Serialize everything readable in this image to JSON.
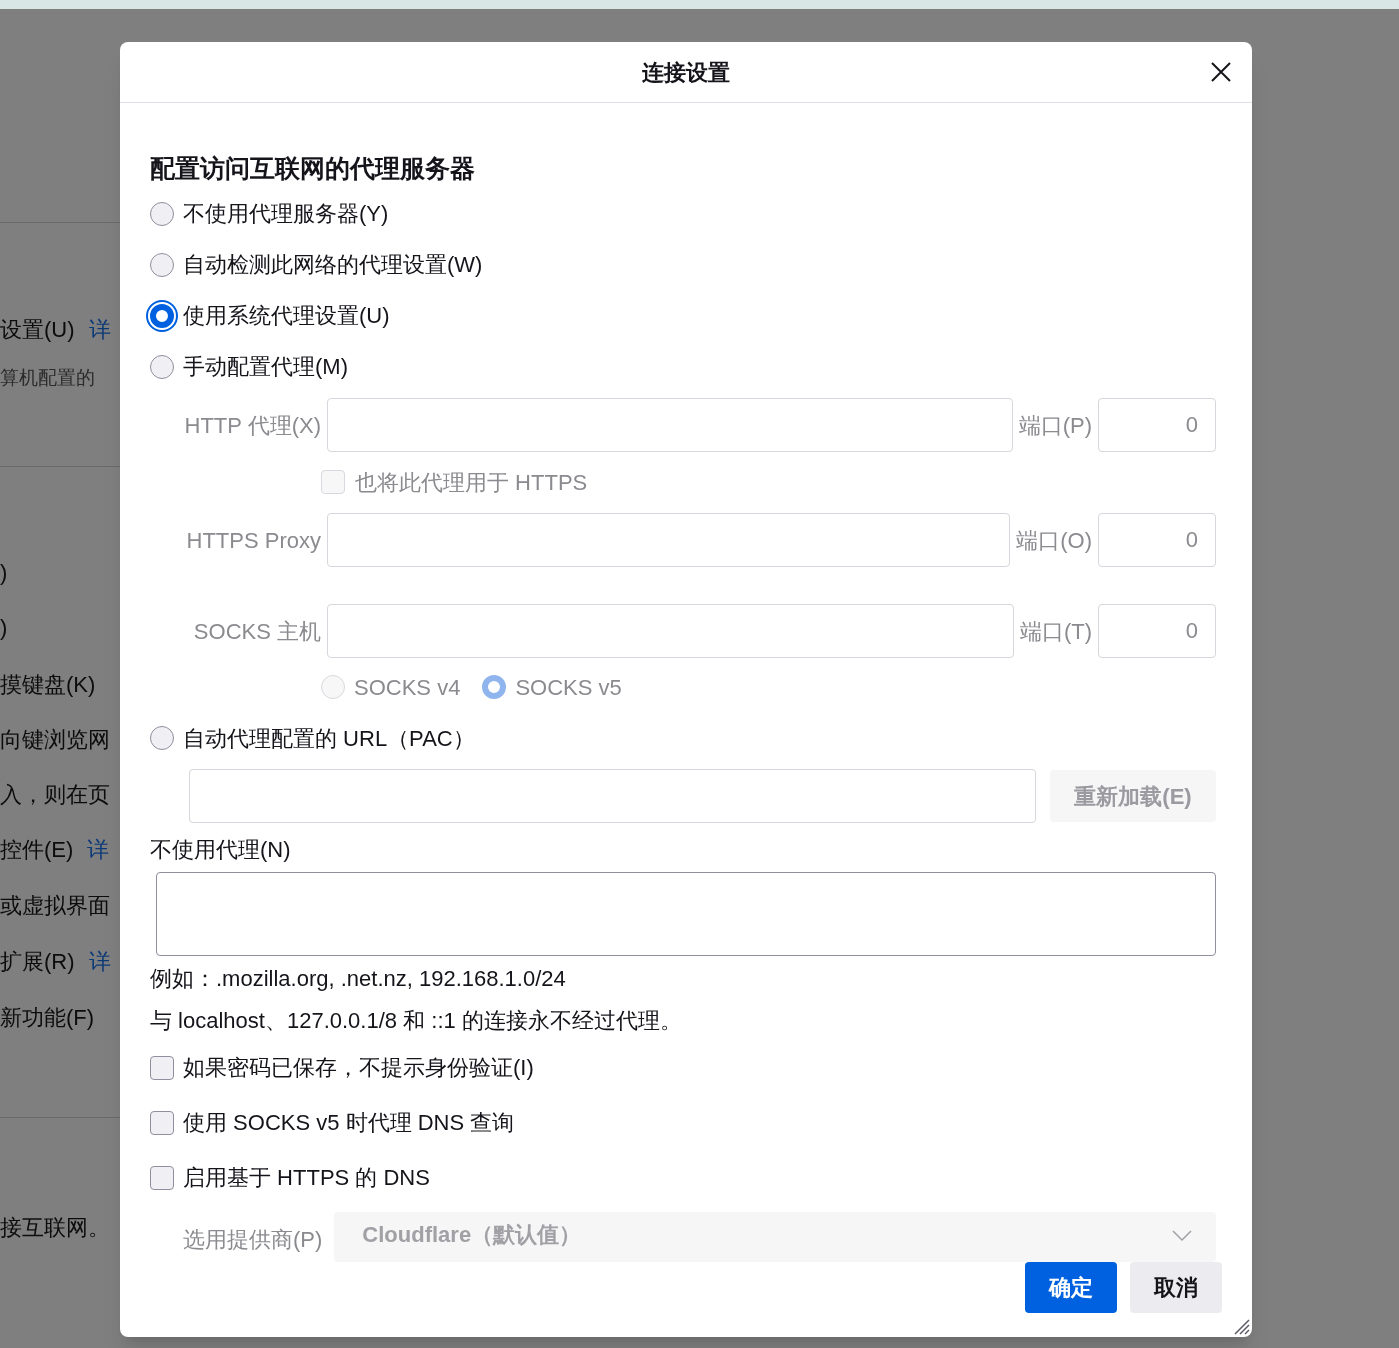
{
  "background_page": [
    {
      "text": "设置(U)",
      "link": "详"
    },
    {
      "text": "算机配置的",
      "kind": "hint"
    },
    {
      "text": ")"
    },
    {
      "text": ")"
    },
    {
      "text": "摸键盘(K)"
    },
    {
      "text": "向键浏览网"
    },
    {
      "text": "入，则在页"
    },
    {
      "text": "控件(E)",
      "link": "详"
    },
    {
      "text": "或虚拟界面"
    },
    {
      "text": "扩展(R)",
      "link": "详"
    },
    {
      "text": "新功能(F)"
    },
    {
      "text": "接互联网。"
    }
  ],
  "window": {
    "title": "连接设置"
  },
  "heading": "配置访问互联网的代理服务器",
  "proxy_modes": [
    {
      "label": "不使用代理服务器(Y)",
      "selected": false
    },
    {
      "label": "自动检测此网络的代理设置(W)",
      "selected": false
    },
    {
      "label": "使用系统代理设置(U)",
      "selected": true
    },
    {
      "label": "手动配置代理(M)",
      "selected": false
    }
  ],
  "manual_rows": [
    {
      "kind": "field",
      "label": "HTTP 代理(X)",
      "disabled": true,
      "port_label": "端口(P)",
      "port_value": "0"
    },
    {
      "kind": "checkbox",
      "label": "也将此代理用于 HTTPS",
      "checked": false,
      "disabled": true
    },
    {
      "kind": "field",
      "label": "HTTPS Proxy",
      "disabled": true,
      "port_label": "端口(O)",
      "port_value": "0"
    },
    {
      "kind": "field",
      "label": "SOCKS 主机",
      "disabled": true,
      "port_label": "端口(T)",
      "port_value": "0"
    },
    {
      "kind": "radios",
      "disabled": true,
      "options": [
        {
          "label": "SOCKS v4",
          "selected": false
        },
        {
          "label": "SOCKS v5",
          "selected": true
        }
      ]
    }
  ],
  "pac": {
    "label": "自动代理配置的 URL（PAC）",
    "selected": false,
    "reload_button": {
      "label": "重新加载(E)",
      "disabled": true
    }
  },
  "no_proxy": {
    "label": "不使用代理(N)",
    "example": "例如：.mozilla.org, .net.nz, 192.168.1.0/24",
    "note": "与 localhost、127.0.0.1/8 和 ::1 的连接永不经过代理。"
  },
  "options": [
    {
      "label": "如果密码已保存，不提示身份验证(I)",
      "checked": false
    },
    {
      "label": "使用 SOCKS v5 时代理 DNS 查询",
      "checked": false
    },
    {
      "label": "启用基于 HTTPS 的 DNS",
      "checked": false
    }
  ],
  "provider": {
    "label": "选用提供商(P)",
    "value": "Cloudflare（默认值）",
    "disabled": true
  },
  "buttons": [
    {
      "label": "确定",
      "kind": "primary"
    },
    {
      "label": "取消",
      "kind": "secondary"
    }
  ]
}
